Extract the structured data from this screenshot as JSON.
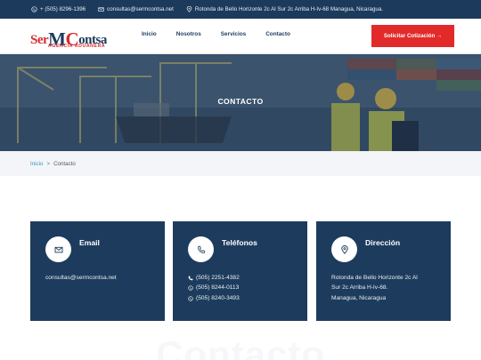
{
  "topbar": {
    "phone": "+ (505) 8296-1396",
    "email": "consultas@sermcontsa.net",
    "address": "Rotonda de Bello Horizonte 2c Al Sur 2c Arriba H-Iv-68 Managua, Nicaragua."
  },
  "logo": {
    "ser": "Ser",
    "m": "M",
    "c": "C",
    "ontsa": "ontsa",
    "tagline": "AGENCIA ADUANERA"
  },
  "nav": {
    "items": [
      "Inicio",
      "Nosotros",
      "Servicios",
      "Contacto"
    ]
  },
  "cta": {
    "label": "Solicitar Cotización →"
  },
  "hero": {
    "title": "CONTACTO"
  },
  "breadcrumb": {
    "home": "Inicio",
    "separator": ">",
    "current": "Contacto"
  },
  "cards": [
    {
      "title": "Email",
      "icon": "envelope-icon",
      "lines": [
        "consultas@sermcontsa.net"
      ]
    },
    {
      "title": "Teléfonos",
      "icon": "phone-icon",
      "lines": [
        "(505) 2251-4382",
        "(505) 8244-0113",
        "(505) 8240-3493"
      ]
    },
    {
      "title": "Dirección",
      "icon": "location-pin-icon",
      "lines": [
        "Rotonda de Bello Horizonte 2c Al",
        "Sur 2c Arriba H-Iv-68.",
        "Managua, Nicaragua"
      ]
    }
  ],
  "ghost_text": "Contacto",
  "colors": {
    "navy": "#1d3c5d",
    "red": "#e22a2a",
    "link": "#3f93c9"
  }
}
